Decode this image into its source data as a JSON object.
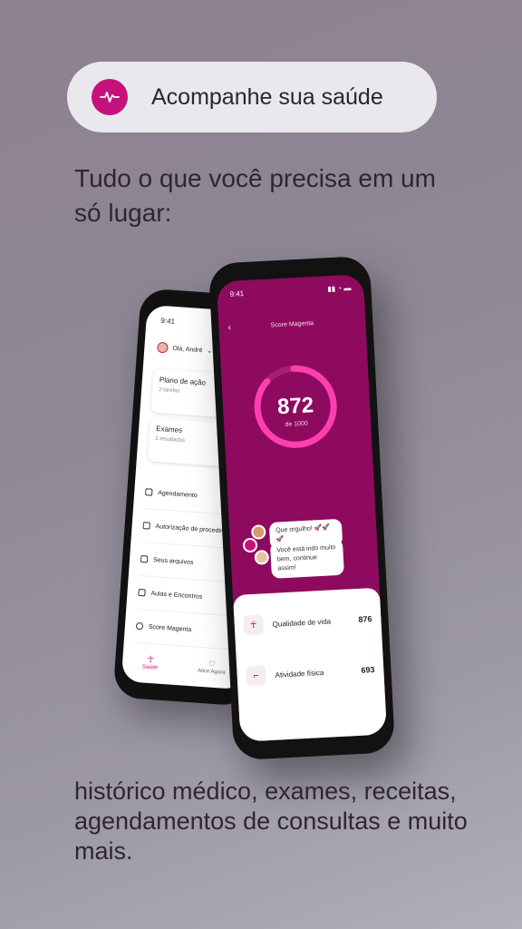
{
  "banner": {
    "label": "Acompanhe sua saúde",
    "icon": "heartbeat-icon"
  },
  "headline": "Tudo o que você precisa em um só lugar:",
  "footer": "histórico médico, exames, receitas, agendamentos de consultas e muito mais.",
  "back_phone": {
    "time": "9:41",
    "greeting": "Olá, André",
    "cards": [
      {
        "title": "Plano de ação",
        "subtitle": "2 tarefas"
      },
      {
        "title": "Exames",
        "subtitle": "2 resultados"
      }
    ],
    "menu": [
      {
        "label": "Agendamento",
        "icon": "calendar-icon"
      },
      {
        "label": "Autorização de procedimentos",
        "icon": "document-icon"
      },
      {
        "label": "Seus arquivos",
        "icon": "cloud-icon"
      },
      {
        "label": "Aulas e Encontros",
        "icon": "diamond-icon"
      },
      {
        "label": "Score Magenta",
        "icon": "heart-icon"
      }
    ],
    "nav": [
      {
        "label": "Saúde",
        "icon": "person-icon"
      },
      {
        "label": "Alice Agora",
        "icon": "heart-outline-icon"
      }
    ]
  },
  "front_phone": {
    "time": "9:41",
    "title": "Score Magenta",
    "score": "872",
    "score_sub": "de 1000",
    "score_progress": 0.872,
    "bubbles": [
      "Que orgulho! 🚀🚀🚀",
      "Você está indo muito bem, continue assim!"
    ],
    "metrics": [
      {
        "label": "Qualidade de vida",
        "value": "876",
        "icon": "person-icon"
      },
      {
        "label": "Atividade física",
        "value": "693",
        "icon": "shoe-icon"
      }
    ]
  },
  "colors": {
    "accent": "#c6117a",
    "magenta_dark": "#8e0a5f"
  }
}
